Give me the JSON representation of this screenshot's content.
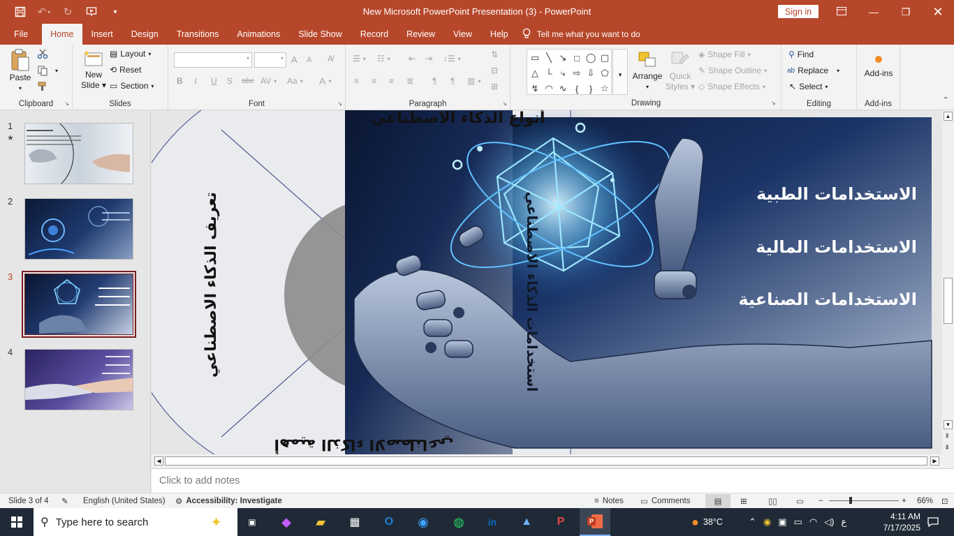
{
  "window": {
    "title": "New Microsoft PowerPoint Presentation (3)  -  PowerPoint",
    "sign_in": "Sign in"
  },
  "tabs": [
    "File",
    "Home",
    "Insert",
    "Design",
    "Transitions",
    "Animations",
    "Slide Show",
    "Record",
    "Review",
    "View",
    "Help"
  ],
  "tell_me": "Tell me what you want to do",
  "ribbon": {
    "clipboard": {
      "paste": "Paste",
      "label": "Clipboard"
    },
    "slides": {
      "new_slide_1": "New",
      "new_slide_2": "Slide",
      "layout": "Layout",
      "reset": "Reset",
      "section": "Section",
      "label": "Slides"
    },
    "font": {
      "label": "Font",
      "bold": "B",
      "italic": "I",
      "underline": "U",
      "strike": "abc",
      "spacing": "AV",
      "case": "Aa",
      "grow": "A",
      "shrink": "A"
    },
    "paragraph": {
      "label": "Paragraph"
    },
    "drawing": {
      "arrange": "Arrange",
      "quick_styles_1": "Quick",
      "quick_styles_2": "Styles",
      "shape_fill": "Shape Fill",
      "shape_outline": "Shape Outline",
      "shape_effects": "Shape Effects",
      "label": "Drawing"
    },
    "editing": {
      "find": "Find",
      "replace": "Replace",
      "select": "Select",
      "label": "Editing"
    },
    "addins": {
      "button": "Add-ins",
      "label": "Add-ins"
    }
  },
  "thumbnails": [
    {
      "num": "1",
      "star": "★"
    },
    {
      "num": "2"
    },
    {
      "num": "3"
    },
    {
      "num": "4"
    }
  ],
  "slide": {
    "arc_title_top": "أنواع الذكاء الاصطناعي",
    "arc_title_left": "تعريف الذكاء الاصطناعي",
    "arc_title_mid": "استخدامات الذكاء الاصطناعي",
    "arc_title_bottom": "أهمية الذكاء الاصطناعي",
    "items": [
      "الاستخدامات الطبية",
      "الاستخدامات المالية",
      "الاستخدامات الصناعية"
    ]
  },
  "notes_placeholder": "Click to add notes",
  "status": {
    "slide_of": "Slide 3 of 4",
    "language": "English (United States)",
    "accessibility": "Accessibility: Investigate",
    "notes": "Notes",
    "comments": "Comments",
    "zoom": "66%"
  },
  "taskbar": {
    "search_placeholder": "Type here to search",
    "temperature": "38°C",
    "lang": "ع",
    "time": "4:11 AM",
    "date": "7/17/2025"
  }
}
